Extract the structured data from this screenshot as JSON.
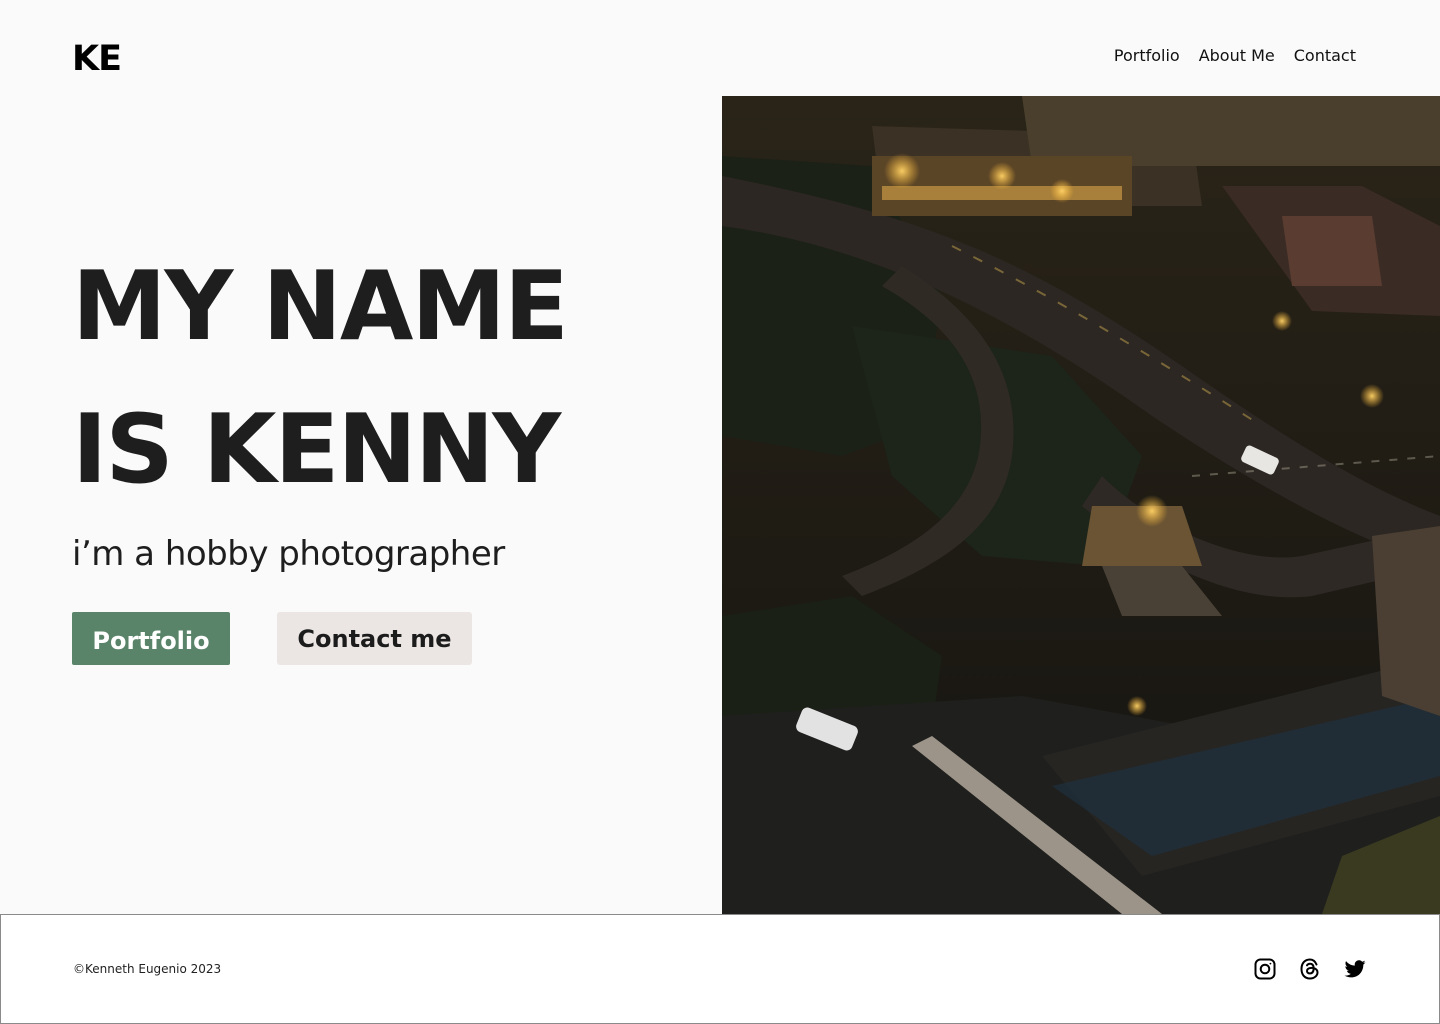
{
  "header": {
    "logo": "KE",
    "nav": [
      {
        "label": "Portfolio"
      },
      {
        "label": "About Me"
      },
      {
        "label": "Contact"
      }
    ]
  },
  "hero": {
    "headline_line1": "MY NAME",
    "headline_line2": "IS KENNY",
    "tagline": "i’m a hobby photographer",
    "primary_button": "Portfolio",
    "secondary_button": "Contact me"
  },
  "photo": {
    "alt_icon": "city-night-photo"
  },
  "footer": {
    "copyright": "©Kenneth Eugenio 2023",
    "socials": [
      {
        "icon": "instagram-icon"
      },
      {
        "icon": "threads-icon"
      },
      {
        "icon": "twitter-icon"
      }
    ]
  },
  "colors": {
    "background": "#fafafa",
    "primary_button": "#5a8469",
    "secondary_button": "#ebe6e3",
    "text": "#1e1e1e"
  }
}
